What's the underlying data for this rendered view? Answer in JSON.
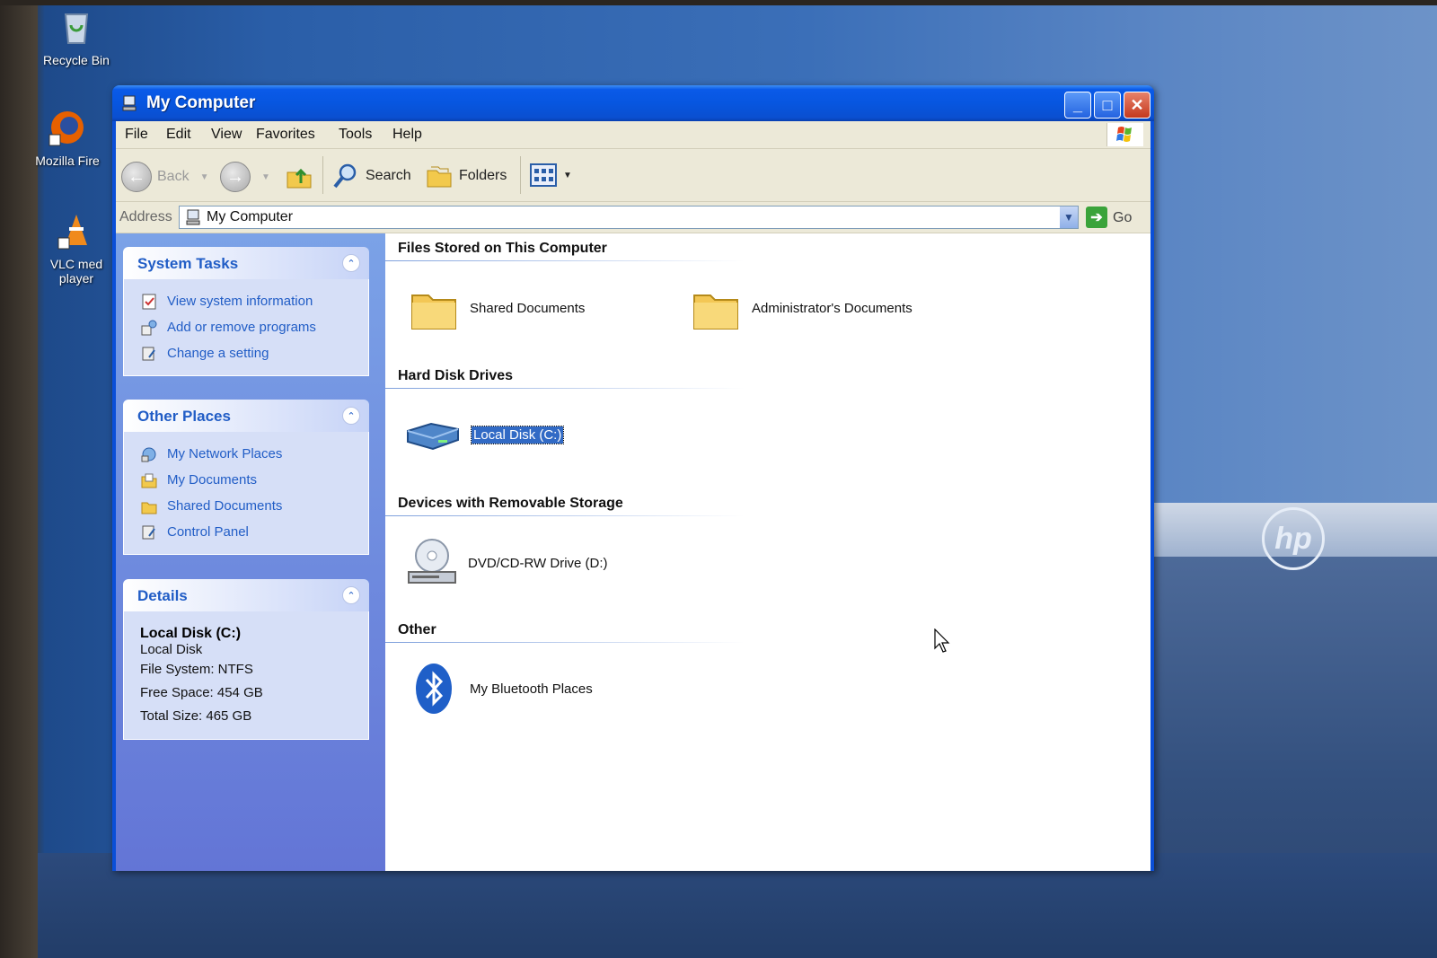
{
  "desktop": {
    "icons": [
      {
        "label": "Recycle Bin"
      },
      {
        "label": "Mozilla Fire"
      },
      {
        "label": "VLC med player"
      }
    ],
    "brand_logo": "hp"
  },
  "window": {
    "title": "My Computer",
    "controls": {
      "minimize": "_",
      "maximize": "□",
      "close": "✕"
    }
  },
  "menubar": {
    "items": [
      "File",
      "Edit",
      "View",
      "Favorites",
      "Tools",
      "Help"
    ]
  },
  "toolbar": {
    "back": "Back",
    "search": "Search",
    "folders": "Folders"
  },
  "address": {
    "label": "Address",
    "value": "My Computer",
    "go": "Go"
  },
  "sidebar": {
    "system_tasks": {
      "title": "System Tasks",
      "items": [
        "View system information",
        "Add or remove programs",
        "Change a setting"
      ]
    },
    "other_places": {
      "title": "Other Places",
      "items": [
        "My Network Places",
        "My Documents",
        "Shared Documents",
        "Control Panel"
      ]
    },
    "details": {
      "title": "Details",
      "name": "Local Disk (C:)",
      "type": "Local Disk",
      "file_system": "File System: NTFS",
      "free_space": "Free Space: 454 GB",
      "total_size": "Total Size: 465 GB"
    }
  },
  "content": {
    "groups": [
      {
        "title": "Files Stored on This Computer",
        "items": [
          "Shared Documents",
          "Administrator's Documents"
        ]
      },
      {
        "title": "Hard Disk Drives",
        "items": [
          "Local Disk (C:)"
        ]
      },
      {
        "title": "Devices with Removable Storage",
        "items": [
          "DVD/CD-RW Drive (D:)"
        ]
      },
      {
        "title": "Other",
        "items": [
          "My Bluetooth Places"
        ]
      }
    ]
  },
  "colors": {
    "titlebar": "#0756e0",
    "task_link": "#215dc6",
    "selection": "#316ac5"
  }
}
